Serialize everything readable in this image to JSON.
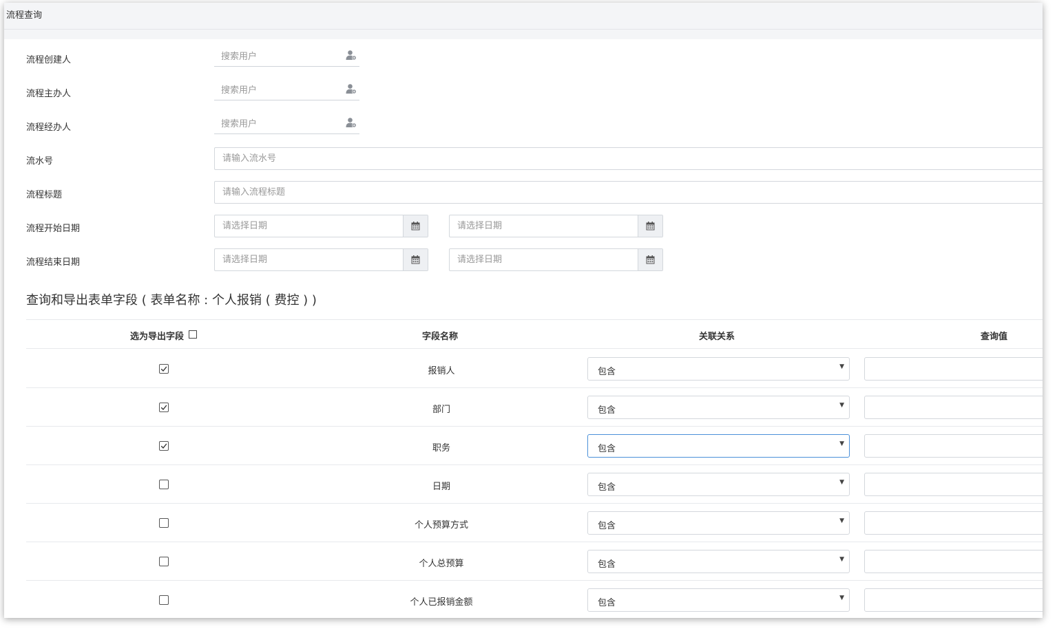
{
  "title": "流程查询",
  "colors": {
    "accent": "#4a90d9",
    "border": "#d3d7dc",
    "title_bar": "#f4f5f7"
  },
  "form": {
    "creator": {
      "label": "流程创建人",
      "placeholder": "搜索用户",
      "icon": "user-add-icon"
    },
    "host": {
      "label": "流程主办人",
      "placeholder": "搜索用户",
      "icon": "user-add-icon"
    },
    "handler": {
      "label": "流程经办人",
      "placeholder": "搜索用户",
      "icon": "user-add-icon"
    },
    "serial": {
      "label": "流水号",
      "placeholder": "请输入流水号"
    },
    "subject": {
      "label": "流程标题",
      "placeholder": "请输入流程标题"
    },
    "start_date": {
      "label": "流程开始日期",
      "from_placeholder": "请选择日期",
      "to_placeholder": "请选择日期",
      "icon": "calendar-icon"
    },
    "end_date": {
      "label": "流程结束日期",
      "from_placeholder": "请选择日期",
      "to_placeholder": "请选择日期",
      "icon": "calendar-icon"
    }
  },
  "section": {
    "title": "查询和导出表单字段 ( 表单名称 : 个人报销 ( 费控 ) )"
  },
  "table": {
    "headers": {
      "export": "选为导出字段",
      "field": "字段名称",
      "relation": "关联关系",
      "value": "查询值"
    },
    "header_checked": false,
    "rows": [
      {
        "checked": true,
        "field": "报销人",
        "relation": "包含",
        "value": ""
      },
      {
        "checked": true,
        "field": "部门",
        "relation": "包含",
        "value": ""
      },
      {
        "checked": true,
        "field": "职务",
        "relation": "包含",
        "value": ""
      },
      {
        "checked": false,
        "field": "日期",
        "relation": "包含",
        "value": ""
      },
      {
        "checked": false,
        "field": "个人预算方式",
        "relation": "包含",
        "value": ""
      },
      {
        "checked": false,
        "field": "个人总预算",
        "relation": "包含",
        "value": ""
      },
      {
        "checked": false,
        "field": "个人已报销金额",
        "relation": "包含",
        "value": ""
      }
    ]
  }
}
